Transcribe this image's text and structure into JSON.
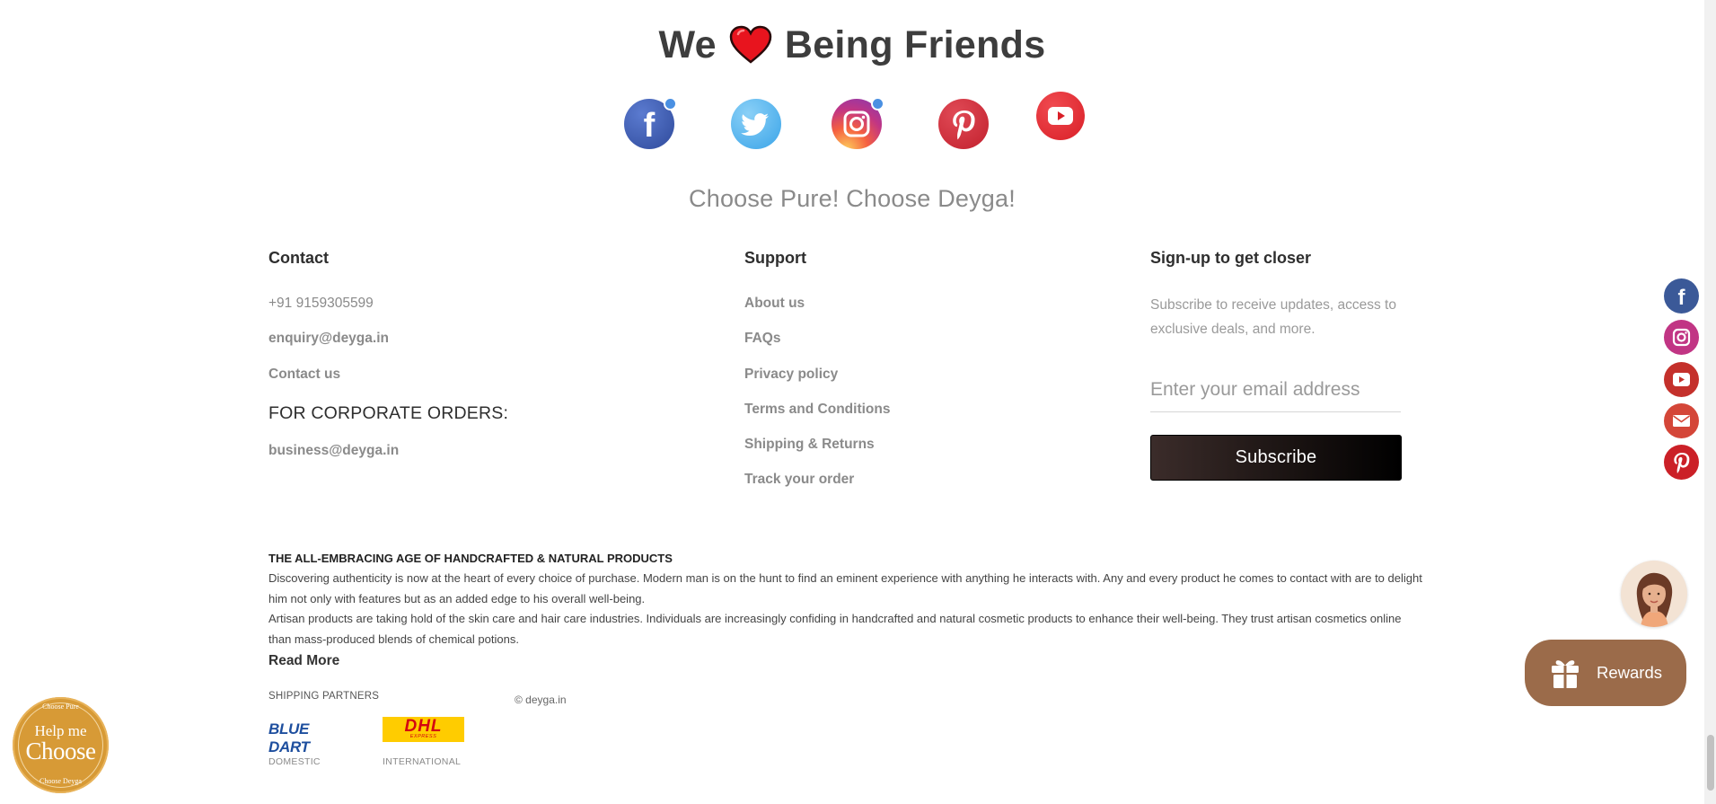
{
  "friends": {
    "title_before": "We",
    "title_after": "Being Friends",
    "heart_icon": "heart-icon",
    "social": [
      {
        "name": "facebook",
        "icon": "facebook-icon",
        "color": "#3b5998",
        "verified": true
      },
      {
        "name": "twitter",
        "icon": "twitter-icon",
        "color": "#55acee",
        "verified": false
      },
      {
        "name": "instagram",
        "icon": "instagram-icon",
        "color": "#c13584",
        "verified": true
      },
      {
        "name": "pinterest",
        "icon": "pinterest-icon",
        "color": "#cb2027",
        "verified": false
      },
      {
        "name": "youtube",
        "icon": "youtube-icon",
        "color": "#e52d27",
        "verified": false
      }
    ]
  },
  "tagline": "Choose Pure! Choose Deyga!",
  "contact": {
    "title": "Contact",
    "phone": "+91 9159305599",
    "email": "enquiry@deyga.in",
    "contact_us": "Contact us",
    "corporate_title": "FOR CORPORATE ORDERS:",
    "business_email": "business@deyga.in"
  },
  "support": {
    "title": "Support",
    "links": [
      "About us",
      "FAQs",
      "Privacy policy",
      "Terms and Conditions",
      "Shipping & Returns",
      "Track your order"
    ]
  },
  "signup": {
    "title": "Sign-up to get closer",
    "description": "Subscribe to receive updates, access to exclusive deals, and more.",
    "email_placeholder": "Enter your email address",
    "button": "Subscribe"
  },
  "seo": {
    "title": "THE ALL-EMBRACING AGE OF HANDCRAFTED & NATURAL PRODUCTS",
    "para1": "Discovering authenticity is now at the heart of every choice of purchase. Modern man is on the hunt to find an eminent experience with anything he interacts with. Any and every product he comes to contact with are to delight him not only with features but as an added edge to his overall well-being.",
    "para2": "Artisan products are taking hold of the skin care and hair care industries. Individuals are increasingly confiding in handcrafted and natural cosmetic products to enhance their well-being. They trust artisan cosmetics online than mass-produced blends of chemical potions.",
    "read_more": "Read More"
  },
  "shipping": {
    "title": "SHIPPING PARTNERS",
    "partners": [
      {
        "logo_text": "BLUE DART",
        "label": "DOMESTIC"
      },
      {
        "logo_text": "DHL",
        "logo_sub": "EXPRESS",
        "label": "INTERNATIONAL"
      }
    ],
    "copyright": "© deyga.in"
  },
  "help_badge": {
    "ring_top": "Choose Pure",
    "ring_bottom": "Choose Deyga",
    "line1": "Help me",
    "line2": "Choose"
  },
  "sidebar_social": [
    {
      "icon": "facebook-icon",
      "color": "#3b5998"
    },
    {
      "icon": "instagram-icon",
      "color": "#c13584"
    },
    {
      "icon": "youtube-icon",
      "color": "#c4302b"
    },
    {
      "icon": "email-icon",
      "color": "#d44638"
    },
    {
      "icon": "pinterest-icon",
      "color": "#cb2027"
    }
  ],
  "rewards": {
    "label": "Rewards",
    "icon": "gift-icon",
    "color": "#9b6b4a"
  }
}
